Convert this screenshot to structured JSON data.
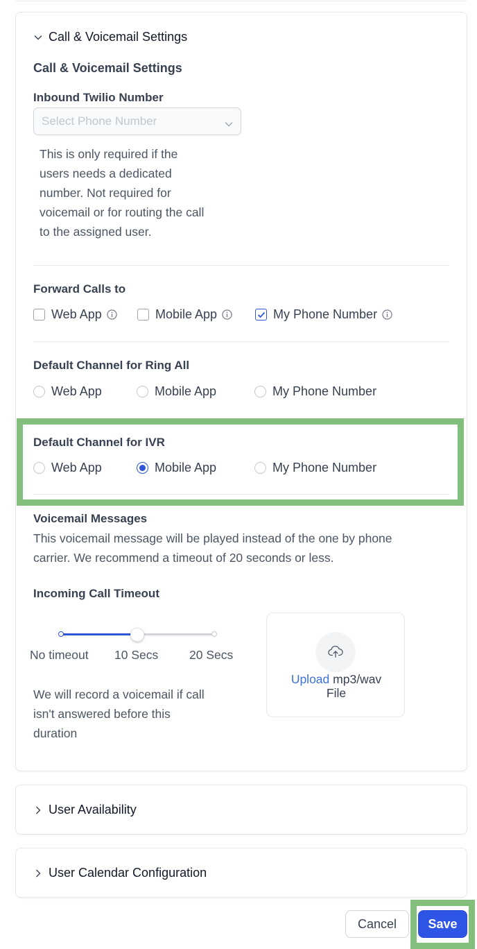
{
  "call_settings": {
    "accordion_title": "Call & Voicemail Settings",
    "section_title": "Call & Voicemail Settings",
    "inbound_number": {
      "label": "Inbound Twilio Number",
      "placeholder": "Select Phone Number",
      "help_lines": [
        "This is only required if the",
        "users needs a dedicated",
        "number. Not required for",
        "voicemail or for routing the call",
        "to the assigned user."
      ]
    },
    "forward_calls": {
      "label": "Forward Calls to",
      "options": [
        {
          "label": "Web App",
          "checked": false
        },
        {
          "label": "Mobile App",
          "checked": false
        },
        {
          "label": "My Phone Number",
          "checked": true
        }
      ]
    },
    "ring_all": {
      "label": "Default Channel for Ring All",
      "options": [
        "Web App",
        "Mobile App",
        "My Phone Number"
      ],
      "selected": null
    },
    "ivr": {
      "label": "Default Channel for IVR",
      "options": [
        "Web App",
        "Mobile App",
        "My Phone Number"
      ],
      "selected": "Mobile App"
    },
    "voicemail": {
      "label": "Voicemail Messages",
      "description_lines": [
        "This voicemail message will be played instead of the one by phone",
        "carrier. We recommend a timeout of 20 seconds or less."
      ]
    },
    "timeout": {
      "label": "Incoming Call Timeout",
      "stops": [
        "No timeout",
        "10 Secs",
        "20 Secs"
      ],
      "selected_index": 1,
      "help_lines": [
        "We will record a voicemail if call",
        "isn't answered before this",
        "duration"
      ]
    },
    "upload": {
      "link": "Upload",
      "text": "mp3/wav",
      "text2": "File",
      "icon": "cloud-upload-icon"
    }
  },
  "user_availability": {
    "title": "User Availability"
  },
  "calendar_config": {
    "title": "User Calendar Configuration"
  },
  "footer": {
    "cancel_label": "Cancel",
    "save_label": "Save"
  },
  "colors": {
    "accent": "#2f55e6",
    "highlight": "#82bf7c",
    "link": "#3b73d9"
  }
}
